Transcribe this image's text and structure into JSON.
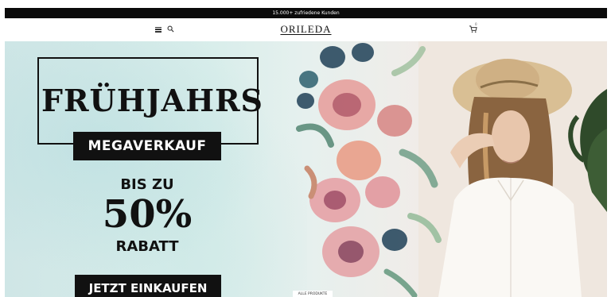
{
  "announcement": {
    "text": "15.000+ zufriedene Kunden"
  },
  "header": {
    "logo": "ORILEDA",
    "icons": {
      "menu": "menu-icon",
      "search": "search-icon",
      "cart": "cart-icon"
    },
    "cart_count": "0"
  },
  "hero": {
    "title": "FRÜHJAHRS",
    "subtitle_badge": "MEGAVERKAUF",
    "discount_prefix": "BIS ZU",
    "discount_value": "50%",
    "discount_suffix": "RABATT",
    "cta_label": "JETZT EINKAUFEN",
    "secondary_link": "ALLE PRODUKTE"
  },
  "colors": {
    "accent": "#111111",
    "announce_bg": "#0b0b0b",
    "hero_bg": "#d9eeeb"
  }
}
